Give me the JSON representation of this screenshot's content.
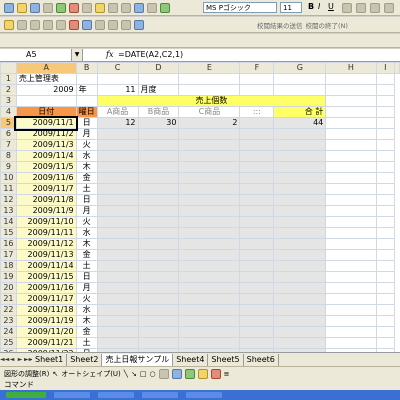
{
  "toolbar": {
    "font_name": "MS Pゴシック",
    "font_size": "11",
    "review_reply_label": "校閲結果の送信",
    "review_end_label": "校閲の終了(N)"
  },
  "formula_bar": {
    "cell_ref": "A5",
    "fx": "fx",
    "formula": "=DATE(A2,C2,1)"
  },
  "columns": [
    "A",
    "B",
    "C",
    "D",
    "E",
    "F",
    "G",
    "H",
    "I"
  ],
  "sheet": {
    "title": "売上管理表",
    "year": "2009",
    "year_suffix": "年",
    "month": "11",
    "month_suffix": "月度",
    "sales_count_header": "売上個数",
    "date_header": "日付",
    "dow_header": "曜日",
    "item_a": "A商品",
    "item_b": "B商品",
    "item_c": "C商品",
    "item_more": ":::",
    "total_header": "合 計",
    "rows": [
      {
        "n": "5",
        "date": "2009/11/1",
        "dow": "日",
        "a": "12",
        "b": "30",
        "c": "2",
        "total": "44"
      },
      {
        "n": "6",
        "date": "2009/11/2",
        "dow": "月"
      },
      {
        "n": "7",
        "date": "2009/11/3",
        "dow": "火"
      },
      {
        "n": "8",
        "date": "2009/11/4",
        "dow": "水"
      },
      {
        "n": "9",
        "date": "2009/11/5",
        "dow": "木"
      },
      {
        "n": "10",
        "date": "2009/11/6",
        "dow": "金"
      },
      {
        "n": "11",
        "date": "2009/11/7",
        "dow": "土"
      },
      {
        "n": "12",
        "date": "2009/11/8",
        "dow": "日"
      },
      {
        "n": "13",
        "date": "2009/11/9",
        "dow": "月"
      },
      {
        "n": "14",
        "date": "2009/11/10",
        "dow": "火"
      },
      {
        "n": "15",
        "date": "2009/11/11",
        "dow": "水"
      },
      {
        "n": "16",
        "date": "2009/11/12",
        "dow": "木"
      },
      {
        "n": "17",
        "date": "2009/11/13",
        "dow": "金"
      },
      {
        "n": "18",
        "date": "2009/11/14",
        "dow": "土"
      },
      {
        "n": "19",
        "date": "2009/11/15",
        "dow": "日"
      },
      {
        "n": "20",
        "date": "2009/11/16",
        "dow": "月"
      },
      {
        "n": "21",
        "date": "2009/11/17",
        "dow": "火"
      },
      {
        "n": "22",
        "date": "2009/11/18",
        "dow": "水"
      },
      {
        "n": "23",
        "date": "2009/11/19",
        "dow": "木"
      },
      {
        "n": "24",
        "date": "2009/11/20",
        "dow": "金"
      },
      {
        "n": "25",
        "date": "2009/11/21",
        "dow": "土"
      },
      {
        "n": "26",
        "date": "2009/11/22",
        "dow": "日"
      },
      {
        "n": "27",
        "date": "2009/11/23",
        "dow": "月"
      }
    ]
  },
  "tabs": [
    "Sheet1",
    "Sheet2",
    "売上日報サンプル",
    "Sheet4",
    "Sheet5",
    "Sheet6"
  ],
  "tab_nav": [
    "◄◄",
    "◄",
    "►",
    "►►"
  ],
  "drawbar": {
    "draw_label": "図形の調整(R)",
    "autoshape_label": "オートシェイプ(U)"
  },
  "status": "コマンド",
  "colors": {
    "date_fill": "#fcfbc8",
    "header_orange": "#f79646",
    "header_yellow": "#ffff66",
    "gray_fill": "#e5e5e5",
    "selected_header": "#f7c878"
  }
}
